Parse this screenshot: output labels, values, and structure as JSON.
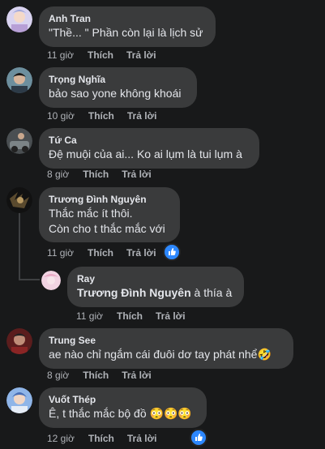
{
  "actions": {
    "like": "Thích",
    "reply": "Trả lời"
  },
  "comments": [
    {
      "author": "Anh Tran",
      "lines": [
        "\"Thề... \" Phần còn lại là lịch sử"
      ],
      "time": "11 giờ"
    },
    {
      "author": "Trọng Nghĩa",
      "lines": [
        "bảo sao yone không khoái"
      ],
      "time": "10 giờ"
    },
    {
      "author": "Tứ Ca",
      "lines": [
        "Đệ muội của ai... Ko ai lụm là tui lụm à"
      ],
      "time": "8 giờ"
    },
    {
      "author": "Trương Đình Nguyên",
      "lines": [
        "Thắc mắc ít thôi.",
        "Còn cho t thắc mắc với"
      ],
      "time": "11 giờ",
      "reaction": "like"
    },
    {
      "author": "Ray",
      "mention": "Trương Đình Nguyên",
      "text_after": " à thía à",
      "time": "11 giờ",
      "reply": true
    },
    {
      "author": "Trung See",
      "lines": [
        "ae nào chỉ ngắm cái đuôi dơ tay phát nhể🤣"
      ],
      "time": "8 giờ"
    },
    {
      "author": "Vuốt Thép",
      "lines": [
        "Ê, t thắc mắc bộ đồ 😳😳😳"
      ],
      "time": "12 giờ",
      "reaction": "like"
    }
  ],
  "colors": {
    "bubble": "#3a3b3c",
    "background": "#18191a",
    "meta": "#b0b3b8",
    "like": "#2d88ff"
  }
}
